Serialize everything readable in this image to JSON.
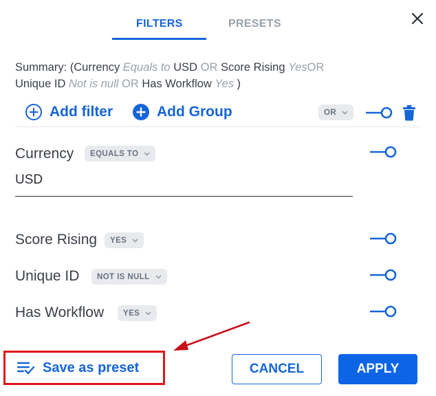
{
  "tabs": [
    {
      "label": "FILTERS",
      "active": true
    },
    {
      "label": "PRESETS",
      "active": false
    }
  ],
  "summary": {
    "prefix": "Summary: (",
    "items": [
      {
        "field": "Currency",
        "op": "Equals to",
        "value": "USD"
      },
      {
        "field": "Score Rising",
        "op": "Yes"
      },
      {
        "field": "Unique ID",
        "op": "Not is null"
      },
      {
        "field": "Has Workflow",
        "op": "Yes"
      }
    ],
    "conjunction": "OR",
    "suffix": ")"
  },
  "toolbar": {
    "add_filter": "Add filter",
    "add_group": "Add Group",
    "group_operator": "OR"
  },
  "filters": [
    {
      "label": "Currency",
      "operator": "EQUALS TO",
      "value": "USD"
    },
    {
      "label": "Score Rising",
      "operator": "YES"
    },
    {
      "label": "Unique ID",
      "operator": "NOT IS NULL"
    },
    {
      "label": "Has Workflow",
      "operator": "YES"
    }
  ],
  "footer": {
    "save_preset": "Save as preset",
    "cancel": "CANCEL",
    "apply": "APPLY"
  },
  "colors": {
    "accent": "#1565d8",
    "apply_bg": "#0d65e6",
    "highlight": "#e0141a",
    "muted": "#9aa1ab"
  },
  "icons": {
    "close": "close-icon",
    "add": "plus-circle-icon",
    "toggle": "toggle-icon",
    "delete": "trash-icon",
    "save": "list-check-icon",
    "annotation": "red-arrow-annotation"
  }
}
